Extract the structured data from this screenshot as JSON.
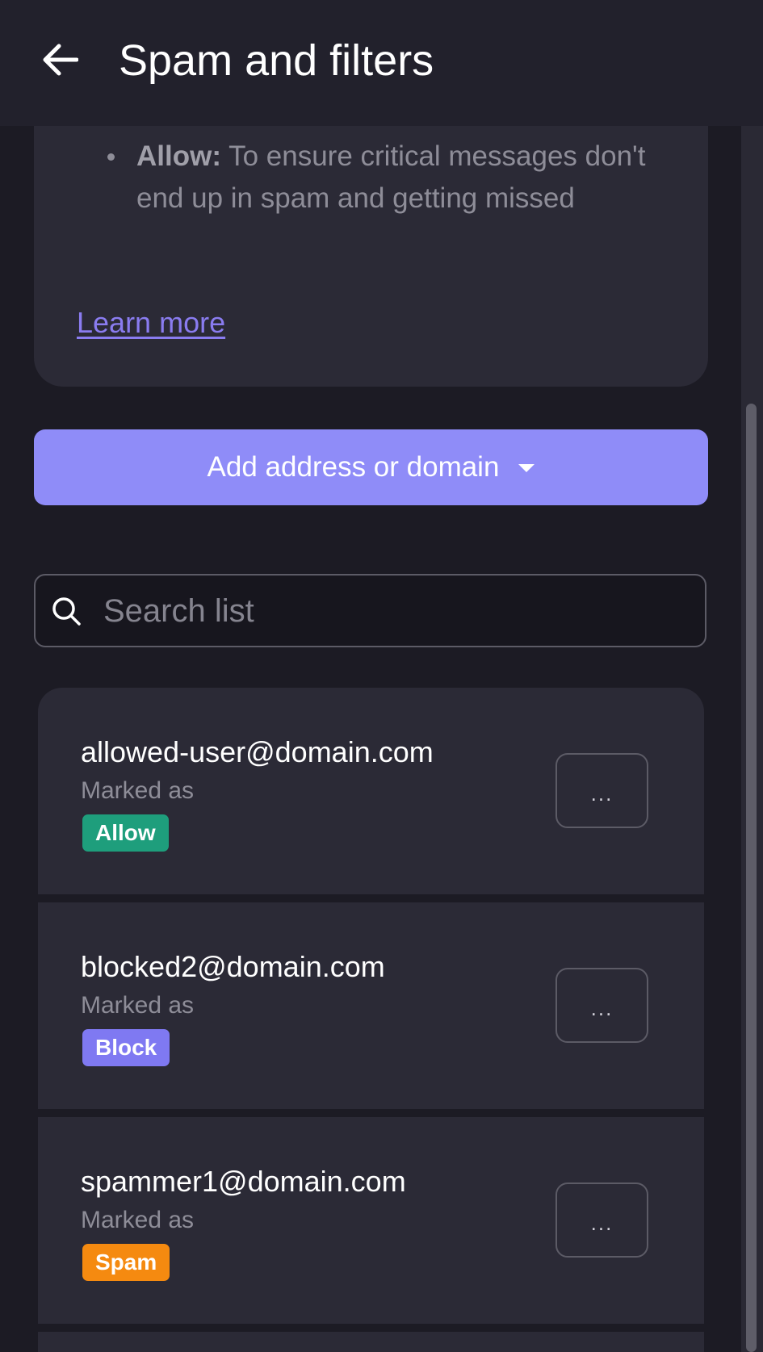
{
  "header": {
    "title": "Spam and filters"
  },
  "info": {
    "allow_term": "Allow:",
    "allow_description": " To ensure critical messages don't end up in spam and getting missed",
    "learn_more": "Learn more"
  },
  "add_button": {
    "label": "Add address or domain"
  },
  "search": {
    "placeholder": "Search list",
    "value": ""
  },
  "list": {
    "items": [
      {
        "address": "allowed-user@domain.com",
        "marked_label": "Marked as",
        "status": "Allow",
        "status_color": "#1e9e7c"
      },
      {
        "address": "blocked2@domain.com",
        "marked_label": "Marked as",
        "status": "Block",
        "status_color": "#7f79f2"
      },
      {
        "address": "spammer1@domain.com",
        "marked_label": "Marked as",
        "status": "Spam",
        "status_color": "#f58a10"
      }
    ],
    "more_label": "..."
  },
  "colors": {
    "background": "#1c1b24",
    "card": "#2b2a36",
    "accent": "#8f8cf8",
    "link": "#8a7cf0"
  },
  "icons": {
    "back": "arrow-left-icon",
    "search": "search-icon",
    "dropdown": "caret-down-icon",
    "more": "more-dots-icon"
  }
}
